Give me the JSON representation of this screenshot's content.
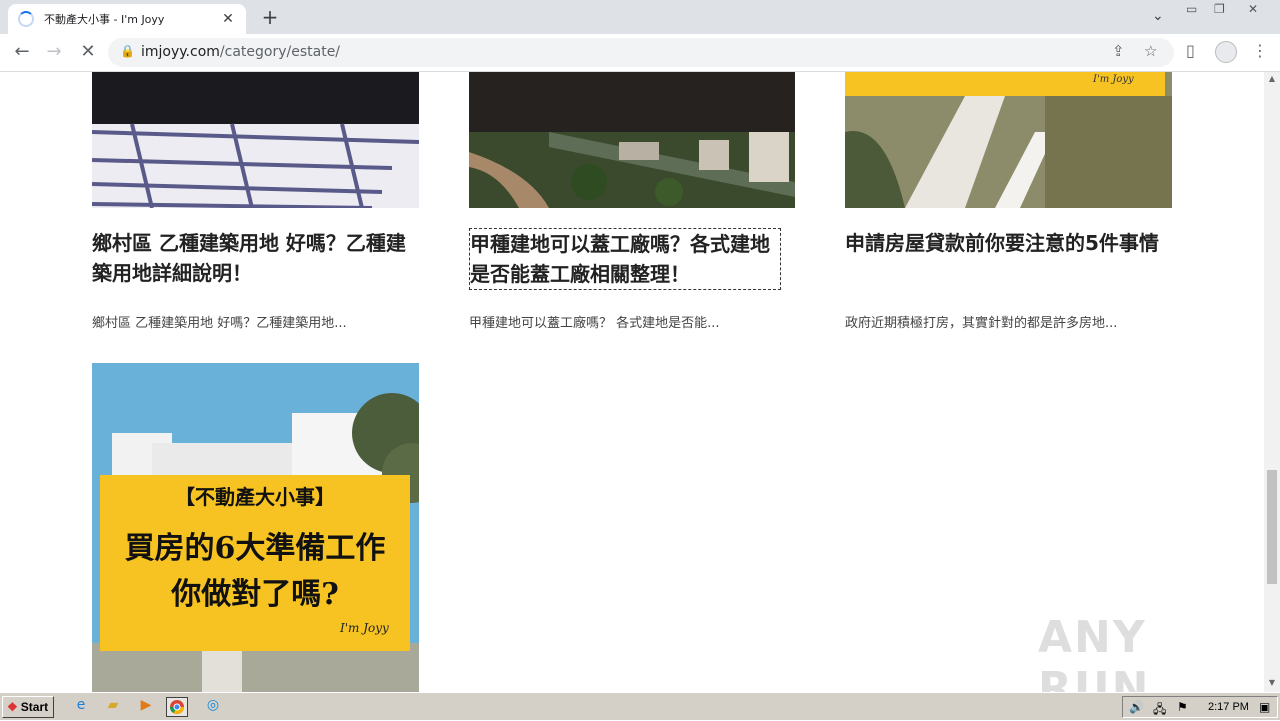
{
  "browser": {
    "tab_title": "不動產大小事 - I'm Joyy",
    "url_host": "imjoyy.com",
    "url_path": "/category/estate/"
  },
  "posts": [
    {
      "title": "鄉村區 乙種建築用地 好嗎？乙種建築用地詳細說明！",
      "excerpt": "鄉村區 乙種建築用地 好嗎？乙種建築用地..."
    },
    {
      "title": "甲種建地可以蓋工廠嗎？各式建地是否能蓋工廠相關整理！",
      "excerpt": "甲種建地可以蓋工廠嗎？ 各式建地是否能..."
    },
    {
      "title": "申請房屋貸款前你要注意的5件事情",
      "excerpt": "政府近期積極打房，其實針對的都是許多房地..."
    }
  ],
  "featured_banner": {
    "heading": "【不動產大小事】",
    "line1": "買房的6大準備工作",
    "line2": "你做對了嗎?",
    "signature": "I'm Joyy"
  },
  "watermark": "ANY RUN",
  "taskbar": {
    "start_label": "Start",
    "clock": "2:17 PM"
  },
  "colors": {
    "banner_yellow": "#f6c323",
    "accent_blue": "#1a73e8"
  }
}
